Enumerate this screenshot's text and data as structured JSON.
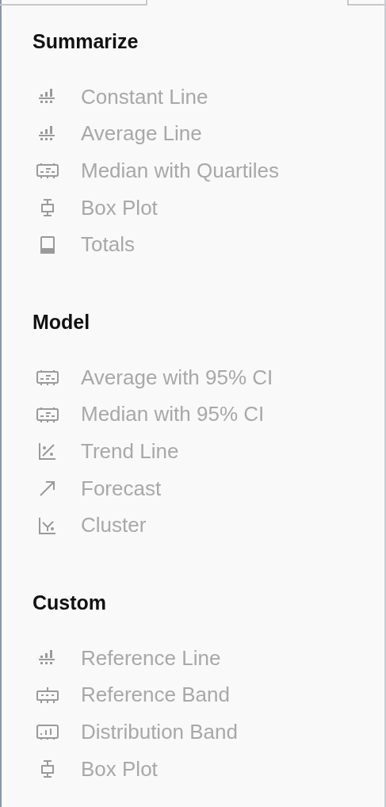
{
  "sections": [
    {
      "title": "Summarize",
      "items": [
        {
          "label": "Constant Line",
          "kind": "line",
          "disabled": true
        },
        {
          "label": "Average Line",
          "kind": "line",
          "disabled": true
        },
        {
          "label": "Median with Quartiles",
          "kind": "band",
          "disabled": true
        },
        {
          "label": "Box Plot",
          "kind": "boxplot",
          "disabled": true
        },
        {
          "label": "Totals",
          "kind": "totals",
          "disabled": true
        }
      ]
    },
    {
      "title": "Model",
      "items": [
        {
          "label": "Average with 95% CI",
          "kind": "band",
          "disabled": true
        },
        {
          "label": "Median with 95% CI",
          "kind": "band",
          "disabled": true
        },
        {
          "label": "Trend Line",
          "kind": "trend",
          "disabled": true
        },
        {
          "label": "Forecast",
          "kind": "forecast",
          "disabled": true
        },
        {
          "label": "Cluster",
          "kind": "cluster",
          "disabled": true
        }
      ]
    },
    {
      "title": "Custom",
      "items": [
        {
          "label": "Reference Line",
          "kind": "line",
          "disabled": true
        },
        {
          "label": "Reference Band",
          "kind": "refband",
          "disabled": true
        },
        {
          "label": "Distribution Band",
          "kind": "distband",
          "disabled": true
        },
        {
          "label": "Box Plot",
          "kind": "boxplot",
          "disabled": true
        }
      ]
    }
  ]
}
